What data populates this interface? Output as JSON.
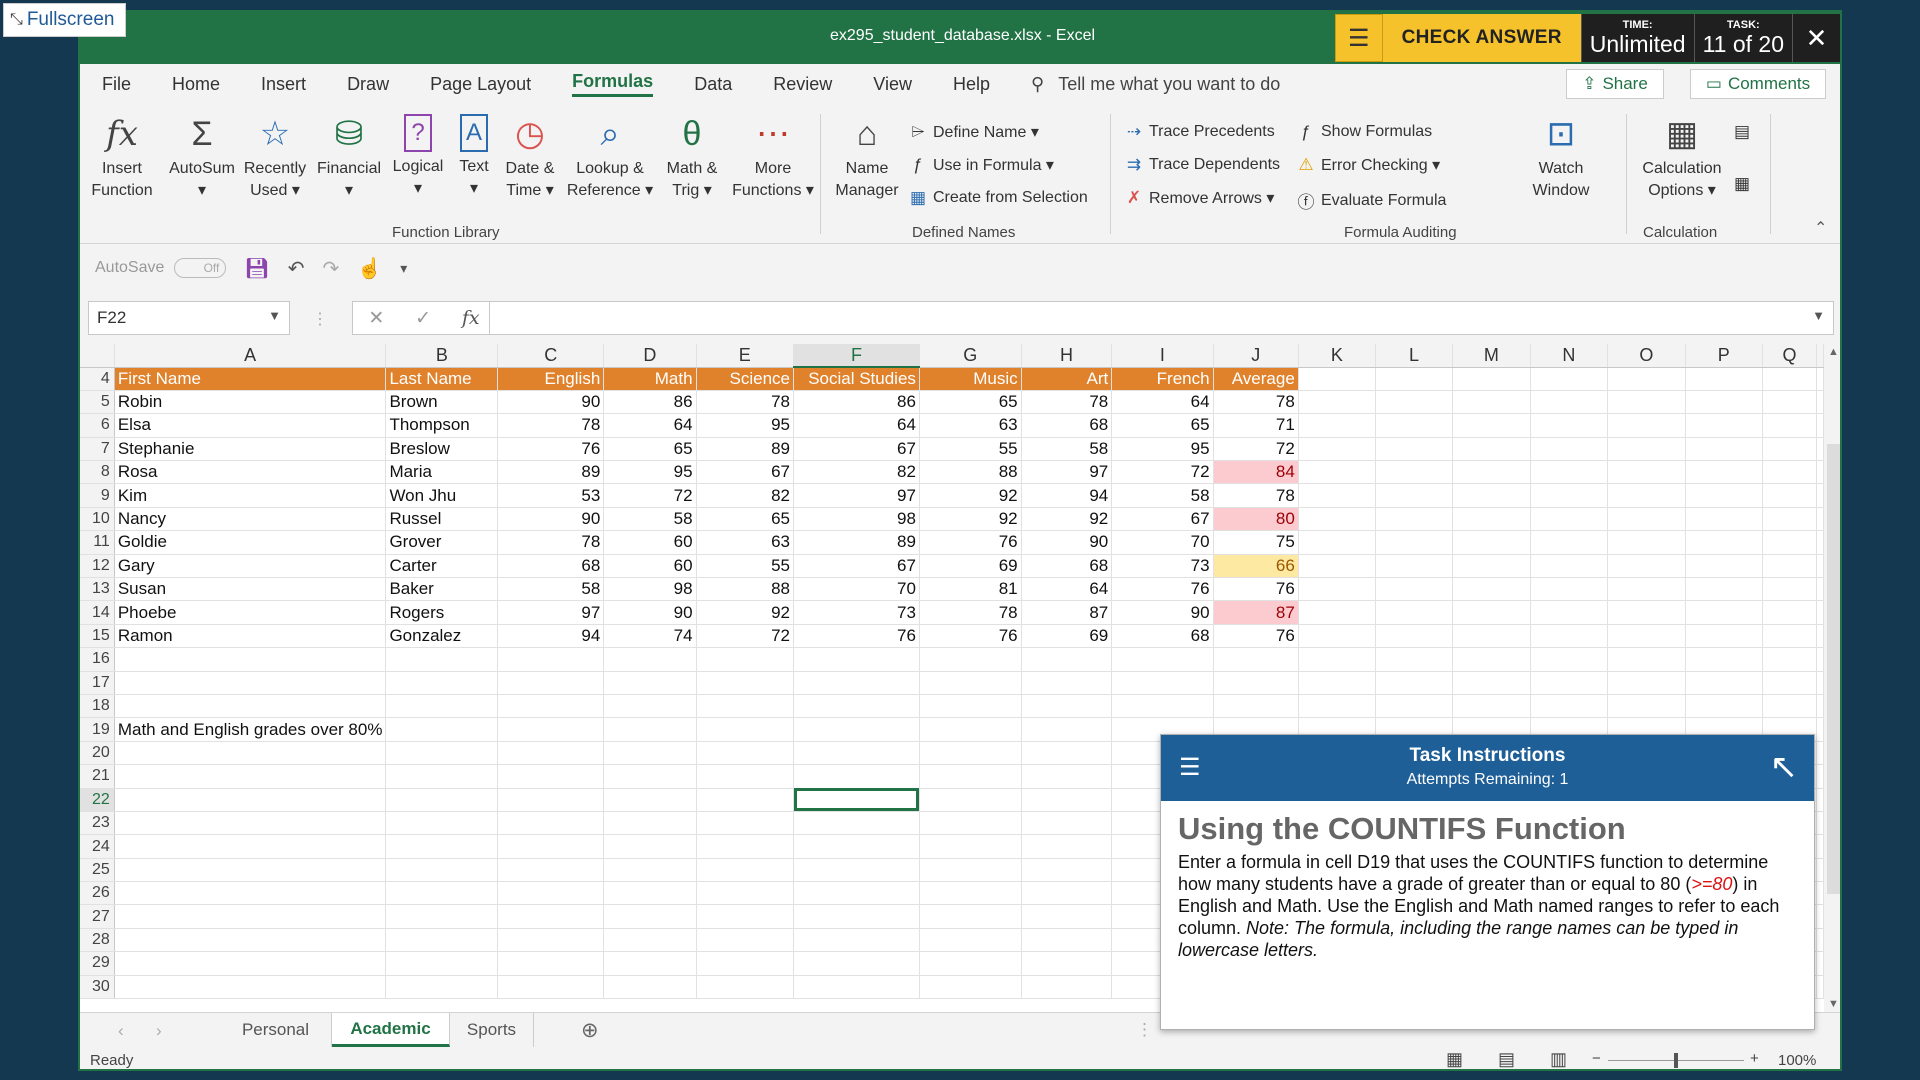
{
  "fullscreen": {
    "label": "Fullscreen"
  },
  "titlebar": {
    "title": "ex295_student_database.xlsx  -  Excel"
  },
  "task_panel": {
    "check_answer": "CHECK ANSWER",
    "time_label": "TIME:",
    "time_value": "Unlimited",
    "task_label": "TASK:",
    "task_value": "11 of 20",
    "close": "✕"
  },
  "menu": {
    "tabs": [
      "File",
      "Home",
      "Insert",
      "Draw",
      "Page Layout",
      "Formulas",
      "Data",
      "Review",
      "View",
      "Help"
    ],
    "active": "Formulas",
    "tell_me": "Tell me what you want to do",
    "share": "Share",
    "comments": "Comments"
  },
  "ribbon": {
    "function_library": {
      "label": "Function Library",
      "insert_function": [
        "Insert",
        "Function"
      ],
      "autosum": [
        "AutoSum",
        "▾"
      ],
      "recently_used": [
        "Recently",
        "Used ▾"
      ],
      "financial": [
        "Financial",
        "▾"
      ],
      "logical": [
        "Logical",
        "▾"
      ],
      "text": [
        "Text",
        "▾"
      ],
      "date_time": [
        "Date &",
        "Time ▾"
      ],
      "lookup": [
        "Lookup &",
        "Reference ▾"
      ],
      "math": [
        "Math &",
        "Trig ▾"
      ],
      "more": [
        "More",
        "Functions ▾"
      ]
    },
    "defined_names": {
      "label": "Defined Names",
      "name_manager": [
        "Name",
        "Manager"
      ],
      "define_name": "Define Name  ▾",
      "use_in_formula": "Use in Formula ▾",
      "create_from_selection": "Create from Selection"
    },
    "formula_auditing": {
      "label": "Formula Auditing",
      "trace_precedents": "Trace Precedents",
      "trace_dependents": "Trace Dependents",
      "remove_arrows": "Remove Arrows  ▾",
      "show_formulas": "Show Formulas",
      "error_checking": "Error Checking  ▾",
      "evaluate_formula": "Evaluate Formula",
      "watch_window": [
        "Watch",
        "Window"
      ]
    },
    "calculation": {
      "label": "Calculation",
      "options": [
        "Calculation",
        "Options ▾"
      ]
    }
  },
  "qat": {
    "autosave": "AutoSave",
    "toggle": "Off"
  },
  "formula_bar": {
    "name_box": "F22",
    "formula": ""
  },
  "columns": [
    "A",
    "B",
    "C",
    "D",
    "E",
    "F",
    "G",
    "H",
    "I",
    "J",
    "K",
    "L",
    "M",
    "N",
    "O",
    "P",
    "Q"
  ],
  "selected_cell": {
    "col": "F",
    "row": 22
  },
  "sheet": {
    "header_row": 4,
    "headers": [
      "First Name",
      "Last Name",
      "English",
      "Math",
      "Science",
      "Social Studies",
      "Music",
      "Art",
      "French",
      "Average"
    ],
    "rows": [
      {
        "r": 5,
        "first": "Robin",
        "last": "Brown",
        "vals": [
          90,
          86,
          78,
          86,
          65,
          78,
          64,
          78
        ],
        "hl": ""
      },
      {
        "r": 6,
        "first": "Elsa",
        "last": "Thompson",
        "vals": [
          78,
          64,
          95,
          64,
          63,
          68,
          65,
          71
        ],
        "hl": ""
      },
      {
        "r": 7,
        "first": "Stephanie",
        "last": "Breslow",
        "vals": [
          76,
          65,
          89,
          67,
          55,
          58,
          95,
          72
        ],
        "hl": ""
      },
      {
        "r": 8,
        "first": "Rosa",
        "last": "Maria",
        "vals": [
          89,
          95,
          67,
          82,
          88,
          97,
          72,
          84
        ],
        "hl": "pink"
      },
      {
        "r": 9,
        "first": "Kim",
        "last": "Won Jhu",
        "vals": [
          53,
          72,
          82,
          97,
          92,
          94,
          58,
          78
        ],
        "hl": ""
      },
      {
        "r": 10,
        "first": "Nancy",
        "last": "Russel",
        "vals": [
          90,
          58,
          65,
          98,
          92,
          92,
          67,
          80
        ],
        "hl": "pink"
      },
      {
        "r": 11,
        "first": "Goldie",
        "last": "Grover",
        "vals": [
          78,
          60,
          63,
          89,
          76,
          90,
          70,
          75
        ],
        "hl": ""
      },
      {
        "r": 12,
        "first": "Gary",
        "last": "Carter",
        "vals": [
          68,
          60,
          55,
          67,
          69,
          68,
          73,
          66
        ],
        "hl": "yellow"
      },
      {
        "r": 13,
        "first": "Susan",
        "last": "Baker",
        "vals": [
          58,
          98,
          88,
          70,
          81,
          64,
          76,
          76
        ],
        "hl": ""
      },
      {
        "r": 14,
        "first": "Phoebe",
        "last": "Rogers",
        "vals": [
          97,
          90,
          92,
          73,
          78,
          87,
          90,
          87
        ],
        "hl": "pink"
      },
      {
        "r": 15,
        "first": "Ramon",
        "last": "Gonzalez",
        "vals": [
          94,
          74,
          72,
          76,
          76,
          69,
          68,
          76
        ],
        "hl": ""
      }
    ],
    "label_row": 19,
    "label_text": "Math and English grades over 80%",
    "last_row": 30
  },
  "sheet_tabs": [
    "Personal",
    "Academic",
    "Sports"
  ],
  "active_sheet": "Academic",
  "status": {
    "ready": "Ready",
    "zoom": "100%"
  },
  "task_instructions": {
    "title": "Task Instructions",
    "attempts": "Attempts Remaining: 1",
    "heading": "Using the COUNTIFS Function",
    "text_1": "Enter a formula in cell D19 that uses the COUNTIFS function to determine how many students have a grade of greater than or equal to 80 (",
    "criteria": ">=80",
    "text_2": ") in English and Math. Use the English and Math named ranges to refer to each column. ",
    "note": "Note: The formula, including the range names can be typed in lowercase letters."
  },
  "colors": {
    "excel_green": "#217346",
    "header_orange": "#e0822b",
    "pink_fill": "#fccbd0",
    "yellow_fill": "#fde9a2",
    "task_blue": "#1f5f97"
  }
}
